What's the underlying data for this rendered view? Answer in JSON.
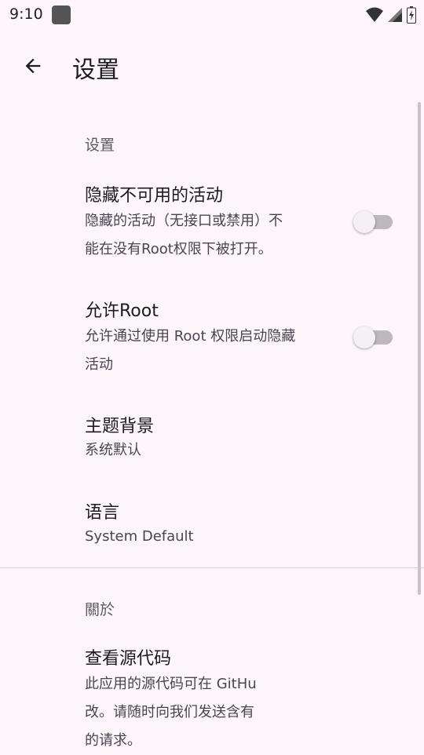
{
  "status_bar": {
    "time": "9:10"
  },
  "app_bar": {
    "title": "设置"
  },
  "sections": [
    {
      "header": "设置",
      "prefs": [
        {
          "title": "隐藏不可用的活动",
          "summary_lines": [
            "隐藏的活动（无接口或禁用）不",
            "能在没有Root权限下被打开。"
          ],
          "switch": false
        },
        {
          "title": "允许Root",
          "summary_lines": [
            "允许通过使用 Root 权限启动隐藏",
            "活动"
          ],
          "switch": false
        },
        {
          "title": "主题背景",
          "summary_lines": [
            "系统默认"
          ]
        },
        {
          "title": "语言",
          "summary_lines": [
            "System Default"
          ]
        }
      ]
    },
    {
      "header": "關於",
      "prefs": [
        {
          "title": "查看源代码",
          "summary_lines": [
            "此应用的源代码可在 GitHu",
            "改。请随时向我们发送含有",
            "的请求。"
          ]
        }
      ]
    }
  ],
  "icons": {
    "back": "arrow-back-icon",
    "wifi": "wifi-icon",
    "signal": "cell-signal-icon",
    "battery": "battery-icon"
  },
  "colors": {
    "background": "#fcf6fb",
    "switch_track": "#bdb7be",
    "switch_thumb": "#f4f0f4"
  }
}
